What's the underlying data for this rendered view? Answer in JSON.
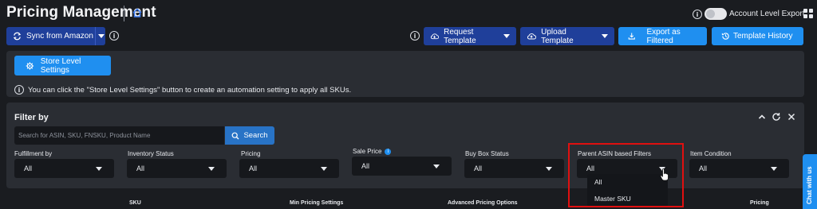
{
  "header": {
    "title": "Pricing Management",
    "account_export_label": "Account Level Export"
  },
  "toolbar": {
    "sync_label": "Sync from Amazon",
    "request_label": "Request Template",
    "upload_label": "Upload Template",
    "export_label": "Export as Filtered",
    "history_label": "Template History"
  },
  "store": {
    "button_label": "Store Level Settings",
    "hint": "You can click the \"Store Level Settings\" button to create an automation setting to apply all SKUs."
  },
  "filters": {
    "title": "Filter by",
    "search_placeholder": "Search for ASIN, SKU, FNSKU, Product Name",
    "search_button": "Search",
    "fields": [
      {
        "label": "Fulfillment by",
        "value": "All"
      },
      {
        "label": "Inventory Status",
        "value": "All"
      },
      {
        "label": "Pricing",
        "value": "All"
      },
      {
        "label": "Sale Price",
        "value": "All"
      },
      {
        "label": "Buy Box Status",
        "value": "All"
      },
      {
        "label": "Parent ASIN based Filters",
        "value": "All"
      },
      {
        "label": "Item Condition",
        "value": "All"
      }
    ],
    "parent_asin_options": [
      "All",
      "Master SKU"
    ]
  },
  "table": {
    "columns": [
      "SKU",
      "Min Pricing Settings",
      "Advanced Pricing Options",
      "Pricing"
    ]
  },
  "chat": {
    "label": "Chat with us"
  },
  "colors": {
    "background": "#1a1c20",
    "panel": "#2a2d33",
    "primary_dark": "#1f3f9a",
    "primary_light": "#1f8ff0",
    "highlight": "#e01010"
  }
}
